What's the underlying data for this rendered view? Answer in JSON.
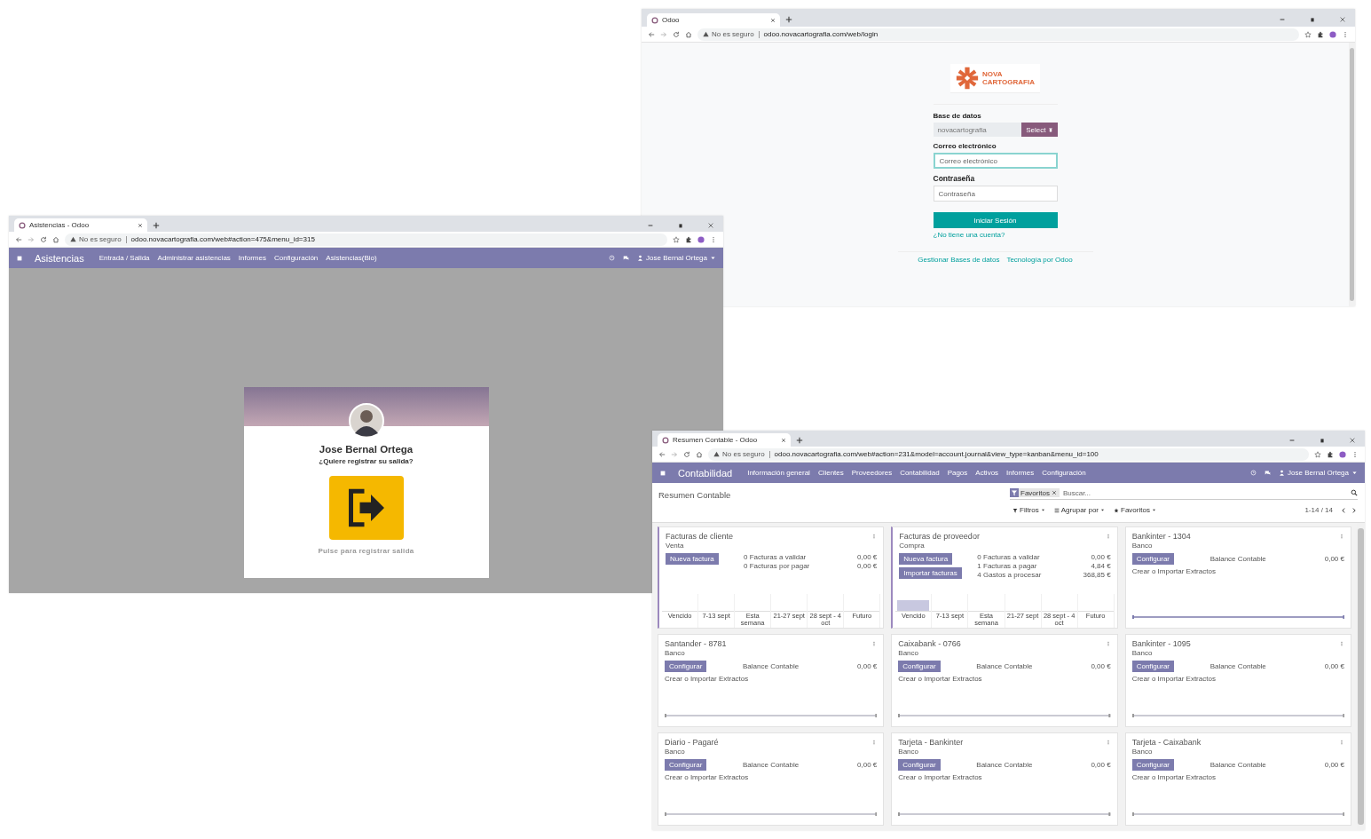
{
  "login_window": {
    "tab": {
      "title": "Odoo"
    },
    "address": {
      "security": "No es seguro",
      "url": "odoo.novacartografia.com/web/login"
    },
    "logo": {
      "lines": [
        "NOVA",
        "CARTOGRAFIA"
      ]
    },
    "form": {
      "database_label": "Base de datos",
      "database_value": "novacartografia",
      "database_button": "Select",
      "email_label": "Correo electrónico",
      "email_placeholder": "Correo electrónico",
      "email_focused": true,
      "password_label": "Contraseña",
      "password_placeholder": "Contraseña",
      "submit": "Iniciar Sesión",
      "signup_link": "¿No tiene una cuenta?"
    },
    "footer_links": [
      "Gestionar Bases de datos",
      "Tecnología por Odoo"
    ]
  },
  "attendance_window": {
    "tab": {
      "title": "Asistencias - Odoo"
    },
    "address": {
      "security": "No es seguro",
      "url": "odoo.novacartografia.com/web#action=475&menu_id=315"
    },
    "navbar": {
      "app": "Asistencias",
      "menu": [
        "Entrada / Salida",
        "Administrar asistencias",
        "Informes",
        "Configuración",
        "Asistencias(Bio)"
      ],
      "user": "Jose Bernal Ortega"
    },
    "kiosk_card": {
      "name": "Jose Bernal Ortega",
      "question": "¿Quiere registrar su salida?",
      "hint": "Pulse para registrar salida"
    }
  },
  "accounting_window": {
    "tab": {
      "title": "Resumen Contable - Odoo"
    },
    "address": {
      "security": "No es seguro",
      "url": "odoo.novacartografia.com/web#action=231&model=account.journal&view_type=kanban&menu_id=100"
    },
    "navbar": {
      "app": "Contabilidad",
      "menu": [
        "Información general",
        "Clientes",
        "Proveedores",
        "Contabilidad",
        "Pagos",
        "Activos",
        "Informes",
        "Configuración"
      ],
      "user": "Jose Bernal Ortega"
    },
    "control_panel": {
      "breadcrumb": "Resumen Contable",
      "facet": "Favoritos",
      "search_placeholder": "Buscar...",
      "buttons": [
        {
          "kind": "filter",
          "label": "Filtros"
        },
        {
          "kind": "group",
          "label": "Agrupar por"
        },
        {
          "kind": "favorite",
          "label": "Favoritos"
        }
      ],
      "pager": "1-14 / 14"
    },
    "journals": [
      {
        "kind": "sales",
        "title": "Facturas de cliente",
        "type": "Venta",
        "highlighted": true,
        "buttons": [
          "Nueva factura"
        ],
        "lines": [
          {
            "label": "0 Facturas a validar",
            "amount": "0,00 €"
          },
          {
            "label": "0 Facturas por pagar",
            "amount": "0,00 €"
          }
        ],
        "chart": [
          {
            "label": "Vencido",
            "filled": false
          },
          {
            "label": "7-13 sept",
            "filled": false
          },
          {
            "label": "Esta semana",
            "filled": false
          },
          {
            "label": "21-27 sept",
            "filled": false
          },
          {
            "label": "28 sept - 4 oct",
            "filled": false
          },
          {
            "label": "Futuro",
            "filled": false
          }
        ]
      },
      {
        "kind": "purchase",
        "title": "Facturas de proveedor",
        "type": "Compra",
        "highlighted": true,
        "buttons": [
          "Nueva factura",
          "Importar facturas"
        ],
        "lines": [
          {
            "label": "0 Facturas a validar",
            "amount": "0,00 €"
          },
          {
            "label": "1 Facturas a pagar",
            "amount": "4,84 €"
          },
          {
            "label": "4 Gastos a procesar",
            "amount": "368,85 €"
          }
        ],
        "chart": [
          {
            "label": "Vencido",
            "filled": true
          },
          {
            "label": "7-13 sept",
            "filled": false
          },
          {
            "label": "Esta semana",
            "filled": false
          },
          {
            "label": "21-27 sept",
            "filled": false
          },
          {
            "label": "28 sept - 4 oct",
            "filled": false
          },
          {
            "label": "Futuro",
            "filled": false
          }
        ]
      },
      {
        "kind": "bank",
        "title": "Bankinter - 1304",
        "type": "Banco",
        "highlighted": false,
        "buttons": [
          "Configurar"
        ],
        "lines": [
          {
            "label": "Balance Contable",
            "amount": "0,00 €"
          }
        ],
        "link": "Crear o Importar Extractos",
        "graph_accent": true
      },
      {
        "kind": "bank",
        "title": "Santander - 8781",
        "type": "Banco",
        "highlighted": false,
        "buttons": [
          "Configurar"
        ],
        "lines": [
          {
            "label": "Balance Contable",
            "amount": "0,00 €"
          }
        ],
        "link": "Crear o Importar Extractos",
        "graph_accent": false
      },
      {
        "kind": "bank",
        "title": "Caixabank - 0766",
        "type": "Banco",
        "highlighted": false,
        "buttons": [
          "Configurar"
        ],
        "lines": [
          {
            "label": "Balance Contable",
            "amount": "0,00 €"
          }
        ],
        "link": "Crear o Importar Extractos",
        "graph_accent": false
      },
      {
        "kind": "bank",
        "title": "Bankinter - 1095",
        "type": "Banco",
        "highlighted": false,
        "buttons": [
          "Configurar"
        ],
        "lines": [
          {
            "label": "Balance Contable",
            "amount": "0,00 €"
          }
        ],
        "link": "Crear o Importar Extractos",
        "graph_accent": false
      },
      {
        "kind": "bank",
        "title": "Diario - Pagaré",
        "type": "Banco",
        "highlighted": false,
        "buttons": [
          "Configurar"
        ],
        "lines": [
          {
            "label": "Balance Contable",
            "amount": "0,00 €"
          }
        ],
        "link": "Crear o Importar Extractos",
        "graph_accent": false
      },
      {
        "kind": "bank",
        "title": "Tarjeta - Bankinter",
        "type": "Banco",
        "highlighted": false,
        "buttons": [
          "Configurar"
        ],
        "lines": [
          {
            "label": "Balance Contable",
            "amount": "0,00 €"
          }
        ],
        "link": "Crear o Importar Extractos",
        "graph_accent": false
      },
      {
        "kind": "bank",
        "title": "Tarjeta - Caixabank",
        "type": "Banco",
        "highlighted": false,
        "buttons": [
          "Configurar"
        ],
        "lines": [
          {
            "label": "Balance Contable",
            "amount": "0,00 €"
          }
        ],
        "link": "Crear o Importar Extractos",
        "graph_accent": false
      }
    ]
  }
}
